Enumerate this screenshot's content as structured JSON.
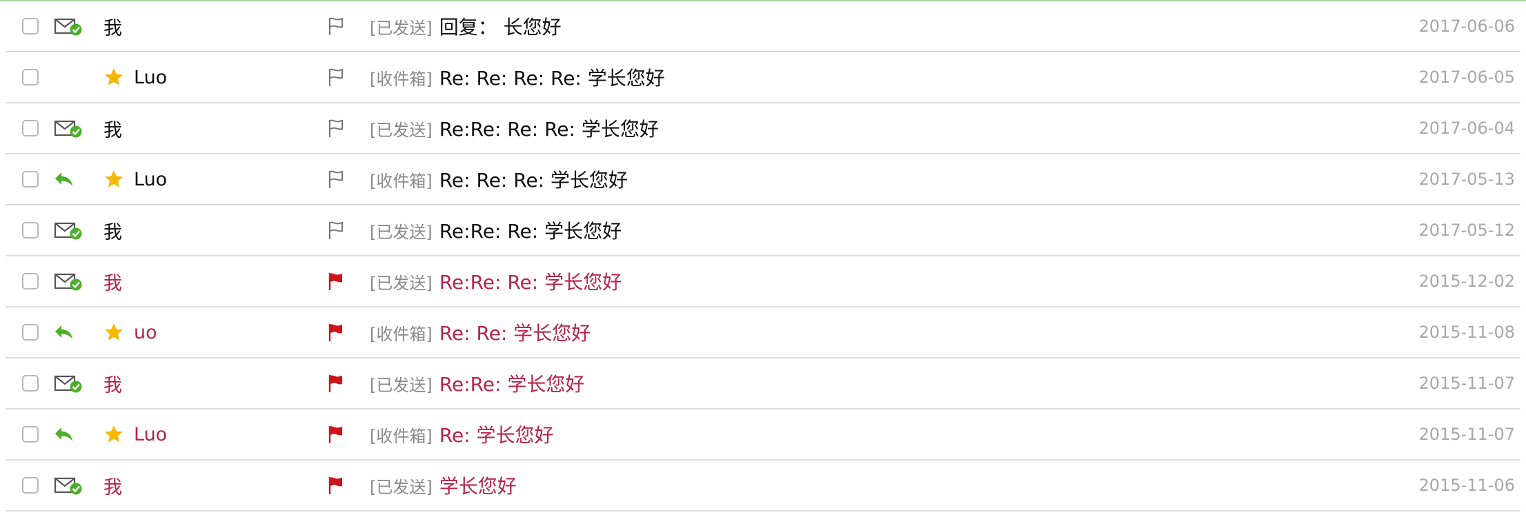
{
  "colors": {
    "accent_flagged": "#b8234a",
    "flag_red": "#d0121b",
    "star_yellow": "#f5b800",
    "reply_green": "#4caf2a",
    "divider": "#dcdcdc",
    "top_border": "#a8d89a",
    "date_gray": "#a8a8a8"
  },
  "mail_list": {
    "rows": [
      {
        "status_icon": "sent-envelope-check-icon",
        "starred": false,
        "sender": "我",
        "flagged": false,
        "folder": "[已发送]",
        "subject": "回复：   长您好",
        "date": "2017-06-06"
      },
      {
        "status_icon": "none",
        "starred": true,
        "sender": "Luo",
        "flagged": false,
        "folder": "[收件箱]",
        "subject": "Re: Re: Re: Re:    学长您好",
        "date": "2017-06-05"
      },
      {
        "status_icon": "sent-envelope-check-icon",
        "starred": false,
        "sender": "我",
        "flagged": false,
        "folder": "[已发送]",
        "subject": "Re:Re: Re: Re:    学长您好",
        "date": "2017-06-04"
      },
      {
        "status_icon": "reply-arrow-icon",
        "starred": true,
        "sender": "Luo",
        "flagged": false,
        "folder": "[收件箱]",
        "subject": "Re: Re: Re:    学长您好",
        "date": "2017-05-13"
      },
      {
        "status_icon": "sent-envelope-check-icon",
        "starred": false,
        "sender": "我",
        "flagged": false,
        "folder": "[已发送]",
        "subject": "Re:Re: Re:    学长您好",
        "date": "2017-05-12"
      },
      {
        "status_icon": "sent-envelope-check-icon",
        "starred": false,
        "sender": "我",
        "flagged": true,
        "folder": "[已发送]",
        "subject": "Re:Re: Re:    学长您好",
        "date": "2015-12-02"
      },
      {
        "status_icon": "reply-arrow-icon",
        "starred": true,
        "sender": "uo",
        "flagged": true,
        "folder": "[收件箱]",
        "subject": "Re: Re:    学长您好",
        "date": "2015-11-08"
      },
      {
        "status_icon": "sent-envelope-check-icon",
        "starred": false,
        "sender": "我",
        "flagged": true,
        "folder": "[已发送]",
        "subject": "Re:Re:    学长您好",
        "date": "2015-11-07"
      },
      {
        "status_icon": "reply-arrow-icon",
        "starred": true,
        "sender": "Luo",
        "flagged": true,
        "folder": "[收件箱]",
        "subject": "Re:    学长您好",
        "date": "2015-11-07"
      },
      {
        "status_icon": "sent-envelope-check-icon",
        "starred": false,
        "sender": "我",
        "flagged": true,
        "folder": "[已发送]",
        "subject": "   学长您好",
        "date": "2015-11-06"
      }
    ]
  }
}
